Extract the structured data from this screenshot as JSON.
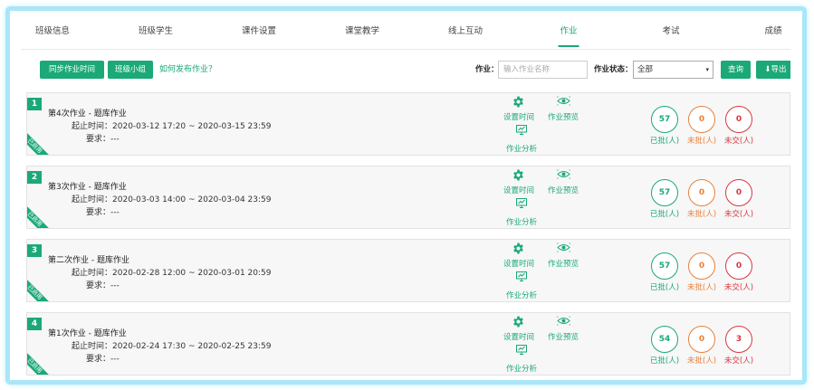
{
  "tabs": [
    {
      "label": "班级信息",
      "active": false
    },
    {
      "label": "班级学生",
      "active": false
    },
    {
      "label": "课件设置",
      "active": false
    },
    {
      "label": "课堂教学",
      "active": false
    },
    {
      "label": "线上互动",
      "active": false
    },
    {
      "label": "作业",
      "active": true
    },
    {
      "label": "考试",
      "active": false
    },
    {
      "label": "成绩",
      "active": false
    }
  ],
  "toolbar": {
    "sync_button": "同步作业时间",
    "group_button": "班级小组",
    "help_link": "如何发布作业？",
    "homework_label": "作业：",
    "homework_placeholder": "输入作业名称",
    "status_label": "作业状态：",
    "status_value": "全部",
    "query_button": "查询",
    "export_button": "导出"
  },
  "colors": {
    "accent": "#1aa977",
    "orange": "#e8803a",
    "red": "#d9363e",
    "frame": "#a9e6f8"
  },
  "actions": {
    "set_time": "设置时间",
    "preview": "作业预览",
    "analysis": "作业分析"
  },
  "stat_labels": {
    "approved": "已批(人)",
    "unapproved": "未批(人)",
    "unsubmitted": "未交(人)"
  },
  "labels": {
    "period": "起止时间：",
    "requirement": "要求："
  },
  "ribbon_text": "已启用",
  "assignments": [
    {
      "index": "1",
      "title": "第4次作业 - 题库作业",
      "period": "2020-03-12 17:20 ~ 2020-03-15 23:59",
      "requirement": "---",
      "approved": "57",
      "unapproved": "0",
      "unsubmitted": "0"
    },
    {
      "index": "2",
      "title": "第3次作业 - 题库作业",
      "period": "2020-03-03 14:00 ~ 2020-03-04 23:59",
      "requirement": "---",
      "approved": "57",
      "unapproved": "0",
      "unsubmitted": "0"
    },
    {
      "index": "3",
      "title": "第二次作业 - 题库作业",
      "period": "2020-02-28 12:00 ~ 2020-03-01 20:59",
      "requirement": "---",
      "approved": "57",
      "unapproved": "0",
      "unsubmitted": "0"
    },
    {
      "index": "4",
      "title": "第1次作业 - 题库作业",
      "period": "2020-02-24 17:30 ~ 2020-02-25 23:59",
      "requirement": "---",
      "approved": "54",
      "unapproved": "0",
      "unsubmitted": "3"
    }
  ]
}
